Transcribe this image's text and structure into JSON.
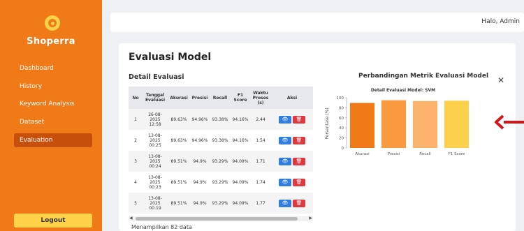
{
  "sidebar": {
    "brand": "Shoperra",
    "items": [
      {
        "label": "Dashboard"
      },
      {
        "label": "History"
      },
      {
        "label": "Keyword Analysis"
      },
      {
        "label": "Dataset"
      },
      {
        "label": "Evaluation",
        "active": true
      }
    ],
    "logout_label": "Logout"
  },
  "topbar": {
    "greeting": "Halo, Admin"
  },
  "main": {
    "title": "Evaluasi Model",
    "section_title": "Detail Evaluasi",
    "table": {
      "columns": [
        "No",
        "Tanggal Evaluasi",
        "Akurasi",
        "Presisi",
        "Recall",
        "F1 Score",
        "Waktu Proses (s)",
        "Aksi"
      ],
      "rows": [
        {
          "no": "1",
          "date": "26-08-2025",
          "time": "12:58",
          "akurasi": "89.63%",
          "presisi": "94.96%",
          "recall": "93.38%",
          "f1": "94.16%",
          "waktu": "2.44"
        },
        {
          "no": "2",
          "date": "13-08-2025",
          "time": "00:25",
          "akurasi": "89.63%",
          "presisi": "94.96%",
          "recall": "93.38%",
          "f1": "94.16%",
          "waktu": "1.54"
        },
        {
          "no": "3",
          "date": "13-08-2025",
          "time": "00:24",
          "akurasi": "89.51%",
          "presisi": "94.9%",
          "recall": "93.29%",
          "f1": "94.09%",
          "waktu": "1.71"
        },
        {
          "no": "4",
          "date": "13-08-2025",
          "time": "00:23",
          "akurasi": "89.51%",
          "presisi": "94.9%",
          "recall": "93.29%",
          "f1": "94.09%",
          "waktu": "1.74"
        },
        {
          "no": "5",
          "date": "13-08-2025",
          "time": "00:19",
          "akurasi": "89.51%",
          "presisi": "94.9%",
          "recall": "93.29%",
          "f1": "94.09%",
          "waktu": "1.77"
        }
      ]
    },
    "footer_note": "Menampilkan 82 data"
  },
  "chart_panel": {
    "title": "Perbandingan Metrik Evaluasi Model",
    "close_icon": "close-icon",
    "arrow_icon": "arrow-left-icon",
    "arrow_color": "#d6151b"
  },
  "chart_data": {
    "type": "bar",
    "title": "Detail Evaluasi Model: SVM",
    "ylabel": "Persentase (%)",
    "xlabel": "",
    "categories": [
      "Akurasi",
      "Presisi",
      "Recall",
      "F1 Score"
    ],
    "values": [
      89.63,
      94.96,
      93.38,
      94.16
    ],
    "colors": [
      "#f07a18",
      "#f99a40",
      "#fbb36c",
      "#fdd04c"
    ],
    "ylim": [
      0,
      100
    ],
    "yticks": [
      0,
      20,
      40,
      60,
      80,
      100
    ],
    "grid": false,
    "legend": "none"
  }
}
